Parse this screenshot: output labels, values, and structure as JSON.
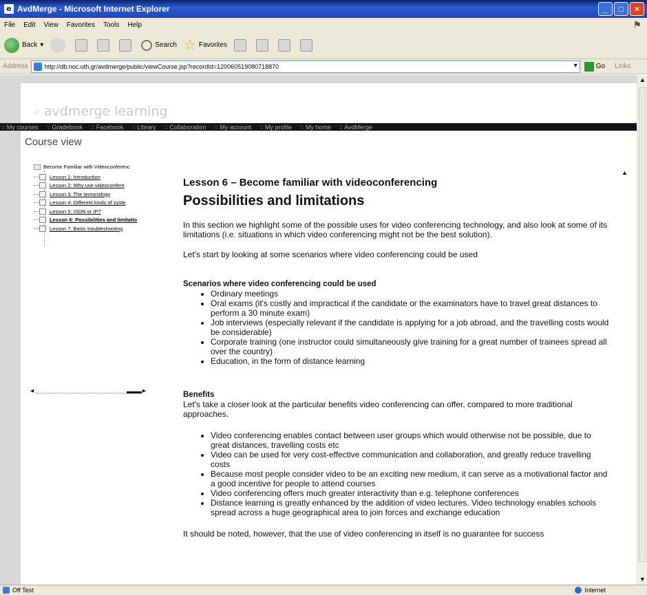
{
  "window": {
    "title": "AvdMerge - Microsoft Internet Explorer"
  },
  "menubar": [
    "File",
    "Edit",
    "View",
    "Favorites",
    "Tools",
    "Help"
  ],
  "toolbar": {
    "back": "Back",
    "search": "Search",
    "favorites": "Favorites"
  },
  "address": {
    "label": "Address",
    "url": "http://db.noc.uth.gr/avdmerge/public/viewCourse.jsp?recordId=120060519080718870",
    "go": "Go",
    "links": "Links"
  },
  "site": {
    "logo": "avdmerge learning",
    "nav": [
      "My courses",
      "Gradebook",
      "Facebook",
      "Library",
      "Collaboration",
      "My account",
      "My profile",
      "My home",
      "AvdMerge"
    ],
    "page_title": "Course view"
  },
  "tree": {
    "root": "Become Familiar with Videoconferenc",
    "items": [
      "Lesson 1: Introduction",
      "Lesson 2: Why use videoconfere",
      "Lesson 3. The terminology",
      "Lesson 4: Different kinds of syste",
      "Lesson 5: ISDN or IP?",
      "Lesson 6: Possibilities and limitatio",
      "Lesson 7. Basic troubleshooting"
    ]
  },
  "article": {
    "lesson": "Lesson 6 – Become familiar with videoconferencing",
    "heading": "Possibilities and limitations",
    "intro": "In this section we highlight some of the possible uses for video conferencing technology, and also look at some of its limitations (i.e. situations in which video conferencing might not be the best solution).",
    "intro2": "Let's start by looking at some scenarios where video conferencing could be used",
    "scenarios_title": "Scenarios where video conferencing could be used",
    "scenarios": [
      "Ordinary meetings",
      "Oral exams (it's costly and impractical if the candidate or the examinators have to travel great distances to perform a 30 minute exam)",
      "Job interviews (especially relevant if the candidate is applying for a job abroad, and the travelling costs would be considerable)",
      "Corporate training (one instructor could simultaneously give training for a great number of trainees spread all over the country)",
      "Education, in the form of distance learning"
    ],
    "benefits_title": "Benefits",
    "benefits_intro": "Let's take a closer look at the particular benefits video conferencing can offer, compared to more traditional approaches.",
    "benefits": [
      "Video conferencing enables contact between user groups which would otherwise not be possible, due to great distances, travelling costs etc",
      "Video can be used for very cost-effective communication and collaboration, and greatly reduce travelling costs",
      "Because most people consider video to be an exciting new medium, it can serve as a motivational factor and a good incentive for people to attend courses",
      "Video conferencing offers much greater interactivity than e.g. telephone conferences",
      "Distance learning is greatly enhanced by the addition of video lectures. Video technology enables schools spread across a huge geographical area to join forces and exchange education"
    ],
    "cutoff": "It should be noted, however, that the use of video conferencing in itself is no guarantee for success"
  },
  "status": {
    "left": "Off Test",
    "zone": "Internet"
  }
}
